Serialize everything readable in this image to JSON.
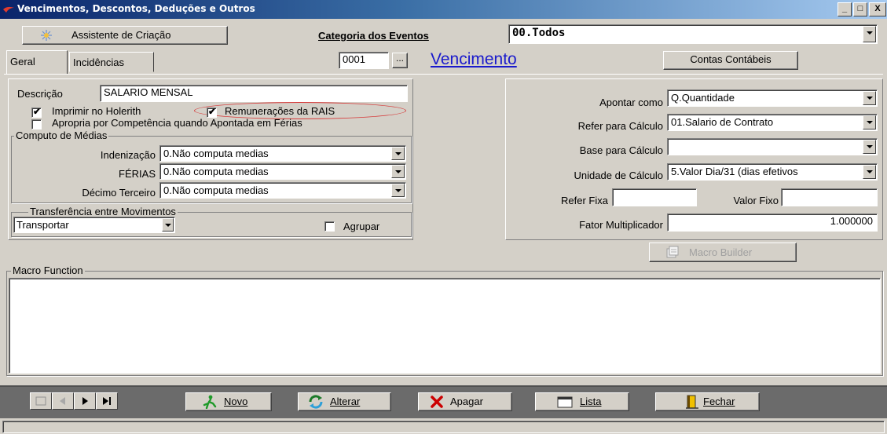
{
  "window": {
    "title": "Vencimentos, Descontos, Deduções e Outros",
    "controls": [
      "_",
      "□",
      "X"
    ]
  },
  "toolbar": {
    "wizard_button": "Assistente de Criação",
    "category_label": "Categoria dos Eventos",
    "category_value": "00.Todos"
  },
  "tabs": [
    {
      "label": "Geral"
    },
    {
      "label": "Incidências"
    }
  ],
  "event": {
    "code": "0001",
    "code_lookup": "...",
    "name": "Vencimento",
    "accounts_button": "Contas Contábeis"
  },
  "left": {
    "description_label": "Descrição",
    "description_value": "SALARIO MENSAL",
    "print_holerith": {
      "label": "Imprimir no Holerith",
      "checked": true
    },
    "rais": {
      "label": "Remunerações da RAIS",
      "checked": true
    },
    "apropria": {
      "label": "Apropria por Competência quando Apontada em Férias",
      "checked": false
    },
    "averages_group": {
      "title": "Computo de Médias",
      "indenizacao": {
        "label": "Indenização",
        "value": "0.Não computa medias"
      },
      "ferias": {
        "label": "FÉRIAS",
        "value": "0.Não computa medias"
      },
      "decimo": {
        "label": "Décimo Terceiro",
        "value": "0.Não computa medias"
      }
    },
    "transfer_group": {
      "title": "Transferência entre Movimentos",
      "value": "Transportar",
      "agrupar": {
        "label": "Agrupar",
        "checked": false
      }
    }
  },
  "right": {
    "apontar": {
      "label": "Apontar como",
      "value": "Q.Quantidade"
    },
    "refer_calc": {
      "label": "Refer para Cálculo",
      "value": "01.Salario de Contrato"
    },
    "base_calc": {
      "label": "Base para Cálculo",
      "value": ""
    },
    "unidade_calc": {
      "label": "Unidade de Cálculo",
      "value": "5.Valor Dia/31 (dias efetivos"
    },
    "refer_fixa": {
      "label": "Refer Fixa",
      "value": ""
    },
    "valor_fixo": {
      "label": "Valor Fixo",
      "value": ""
    },
    "fator": {
      "label": "Fator Multiplicador",
      "value": "1.000000"
    }
  },
  "macro": {
    "builder_button": "Macro Builder",
    "function_title": "Macro Function",
    "function_text": ""
  },
  "footer": {
    "novo": "Novo",
    "alterar": "Alterar",
    "apagar": "Apagar",
    "lista": "Lista",
    "fechar": "Fechar"
  },
  "colors": {
    "face": "#d4d0c8",
    "title_start": "#0a246a",
    "link": "#1a1acc",
    "highlight": "#d63a3a",
    "delete_red": "#cc0000"
  }
}
